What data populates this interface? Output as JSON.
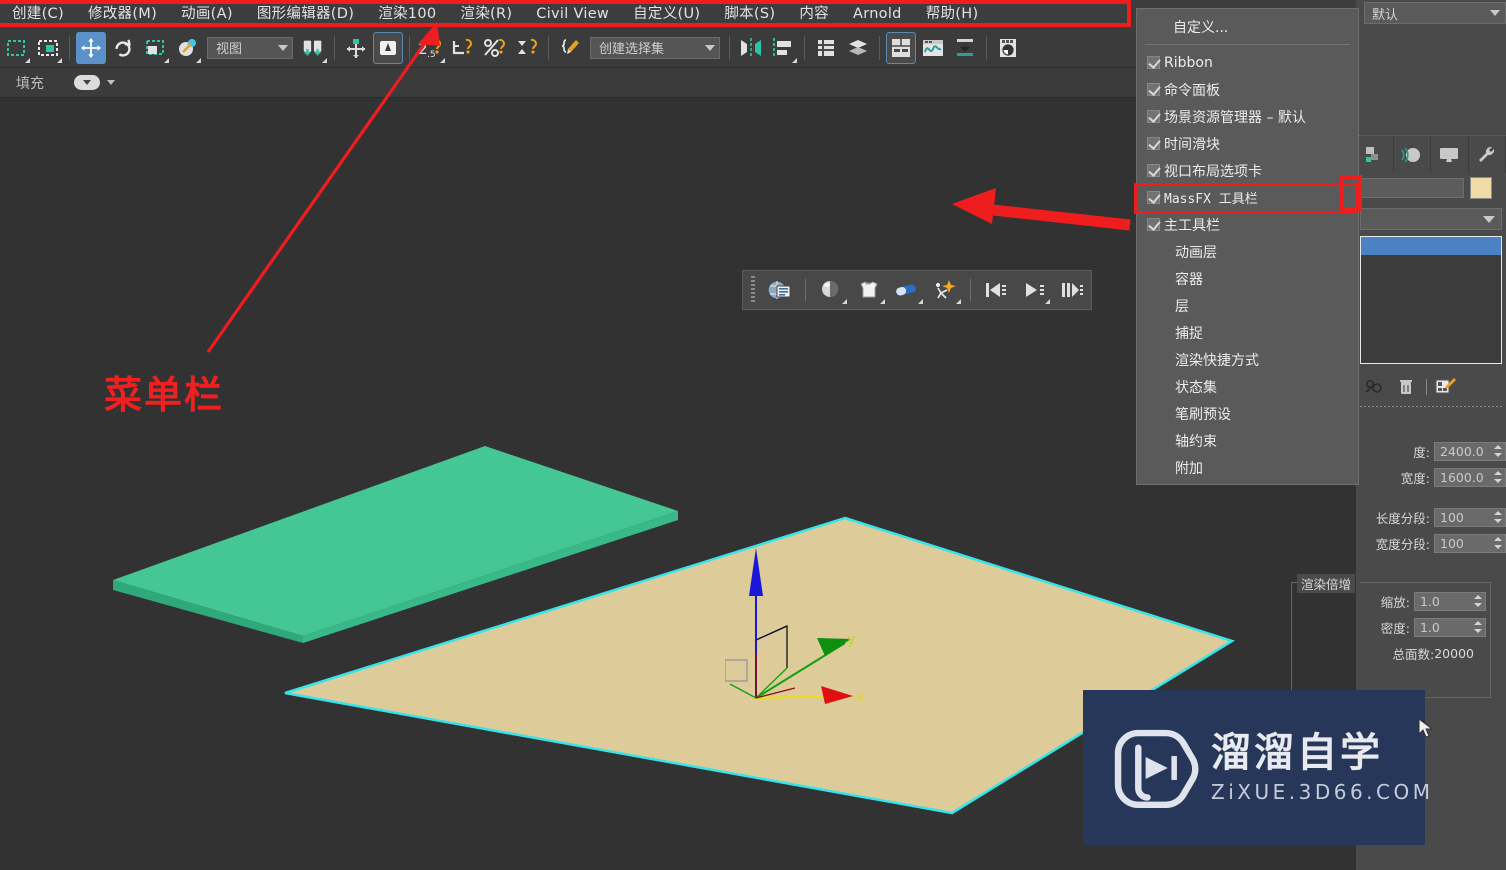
{
  "app": {
    "title": "3ds Max",
    "accent_blue": "#5a91c9",
    "annotation_red": "#ef1d1d",
    "viewport_bg": "#323232"
  },
  "menubar": {
    "items": [
      {
        "label": "创建(C)",
        "mnemonic": "C"
      },
      {
        "label": "修改器(M)",
        "mnemonic": "M"
      },
      {
        "label": "动画(A)",
        "mnemonic": "A"
      },
      {
        "label": "图形编辑器(D)",
        "mnemonic": "D"
      },
      {
        "label": "渲染100",
        "mnemonic": ""
      },
      {
        "label": "渲染(R)",
        "mnemonic": "R"
      },
      {
        "label": "Civil View",
        "mnemonic": ""
      },
      {
        "label": "自定义(U)",
        "mnemonic": "U"
      },
      {
        "label": "脚本(S)",
        "mnemonic": "S"
      },
      {
        "label": "内容",
        "mnemonic": ""
      },
      {
        "label": "Arnold",
        "mnemonic": ""
      },
      {
        "label": "帮助(H)",
        "mnemonic": "H"
      }
    ]
  },
  "main_toolbar": {
    "reference_coordinate_system": "视图",
    "named_selection_sets": "创建选择集",
    "icons": [
      "select-object-icon",
      "select-by-name-icon",
      "select-region-icon",
      "select-and-move-icon",
      "select-and-rotate-icon",
      "select-and-scale-icon",
      "select-and-place-icon",
      "reference-coordinate-system-dropdown",
      "use-pivot-point-center-icon",
      "select-and-manipulate-icon",
      "snaps-toggle-icon",
      "snaps-3d-icon",
      "angle-snap-icon",
      "percent-snap-icon",
      "spinner-snap-icon",
      "named-selection-sets-icon",
      "mirror-icon",
      "align-icon",
      "layer-explorer-icon",
      "layer-manager-icon",
      "curve-editor-icon",
      "schematic-view-icon",
      "material-editor-icon",
      "render-setup-icon",
      "rendered-frame-window-icon"
    ]
  },
  "fill_strip": {
    "label": "填充",
    "icon": "fill-dropdown-icon"
  },
  "massfx_toolbar": {
    "name": "MassFX 工具栏",
    "buttons": [
      "massfx-world-parameters-icon",
      "rigid-body-dynamic-icon",
      "mcloth-icon",
      "constraint-icon",
      "ragdoll-icon",
      "reset-simulation-icon",
      "start-simulation-icon",
      "step-simulation-icon"
    ]
  },
  "customize_menu": {
    "header": "自定义...",
    "items": [
      {
        "label": "Ribbon",
        "checked": true
      },
      {
        "label": "命令面板",
        "checked": true
      },
      {
        "label": "场景资源管理器 – 默认",
        "checked": true
      },
      {
        "label": "时间滑块",
        "checked": true
      },
      {
        "label": "视口布局选项卡",
        "checked": true
      },
      {
        "label": "MassFX 工具栏",
        "checked": true,
        "highlighted": true
      },
      {
        "label": "主工具栏",
        "checked": true
      },
      {
        "label": "动画层",
        "checked": false
      },
      {
        "label": "容器",
        "checked": false
      },
      {
        "label": "层",
        "checked": false
      },
      {
        "label": "捕捉",
        "checked": false
      },
      {
        "label": "渲染快捷方式",
        "checked": false
      },
      {
        "label": "状态集",
        "checked": false
      },
      {
        "label": "笔刷预设",
        "checked": false
      },
      {
        "label": "轴约束",
        "checked": false
      },
      {
        "label": "附加",
        "checked": false
      }
    ]
  },
  "command_panel": {
    "scene_explorer_preset": "默认",
    "tabs": [
      "create-tab-icon",
      "modify-tab-icon",
      "hierarchy-tab-icon",
      "motion-tab-icon",
      "display-tab-icon",
      "utilities-tab-icon"
    ],
    "object_name": "",
    "object_color": "#f0dba6",
    "modifier_list_selected": "",
    "modifier_icons": [
      "pin-stack-icon",
      "show-end-result-icon",
      "make-unique-icon",
      "remove-modifier-icon",
      "configure-modifier-sets-icon"
    ],
    "parameters": {
      "group_title": "渲染倍增",
      "rows": [
        {
          "label": "度:",
          "value": "2400.0",
          "name": "length-field"
        },
        {
          "label": "宽度:",
          "value": "1600.0",
          "name": "width-field"
        },
        {
          "label": "长度分段:",
          "value": "100",
          "name": "length-segments-field"
        },
        {
          "label": "宽度分段:",
          "value": "100",
          "name": "width-segments-field"
        },
        {
          "label": "缩放:",
          "value": "1.0",
          "name": "scale-field"
        },
        {
          "label": "密度:",
          "value": "1.0",
          "name": "density-field"
        }
      ],
      "total_faces_label": "总面数:",
      "total_faces_value": "20000"
    }
  },
  "annotations": {
    "menubar_callout": "菜单栏",
    "boxes": [
      "menubar-highlight-box",
      "massfx-item-highlight-box",
      "panel-edge-highlight-box"
    ],
    "arrows": [
      "arrow-to-menubar",
      "arrow-to-massfx-item"
    ]
  },
  "viewport": {
    "objects": [
      {
        "name": "green-box-slab",
        "color": "#45c695",
        "selected": false
      },
      {
        "name": "tan-plane",
        "color": "#ddcb9a",
        "selected": true,
        "selection_outline": "#36e4ea"
      }
    ],
    "gizmo": {
      "name": "move-gizmo",
      "axes": [
        {
          "axis": "x",
          "color": "#e01010",
          "label": "x"
        },
        {
          "axis": "y",
          "color": "#12a012",
          "label": "y"
        },
        {
          "axis": "z",
          "color": "#1a18d8",
          "label": ""
        }
      ]
    }
  },
  "watermark": {
    "title": "溜溜自学",
    "subtitle": "ZiXUE.3D66.COM",
    "bg": "#263759",
    "logo": "play-button-logo"
  }
}
